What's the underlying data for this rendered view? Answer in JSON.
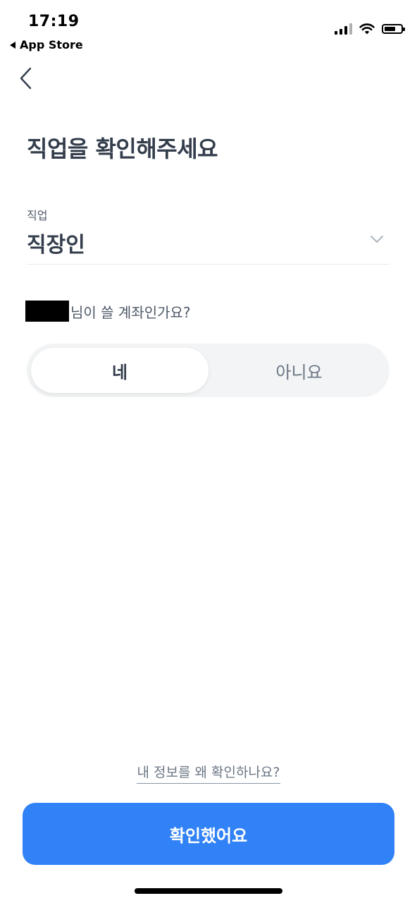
{
  "status_bar": {
    "time": "17:19",
    "back_app": "App Store"
  },
  "page": {
    "title": "직업을 확인해주세요"
  },
  "job_field": {
    "label": "직업",
    "value": "직장인"
  },
  "question": {
    "text": "님이 쓸 계좌인가요?"
  },
  "segment": {
    "yes_label": "네",
    "no_label": "아니요",
    "selected": "네"
  },
  "footer": {
    "why_link": "내 정보를 왜 확인하나요?",
    "confirm_label": "확인했어요"
  },
  "colors": {
    "accent": "#3182f6",
    "title_text": "#333d4b",
    "muted_text": "#6b7684",
    "segment_bg": "#f2f4f6"
  }
}
